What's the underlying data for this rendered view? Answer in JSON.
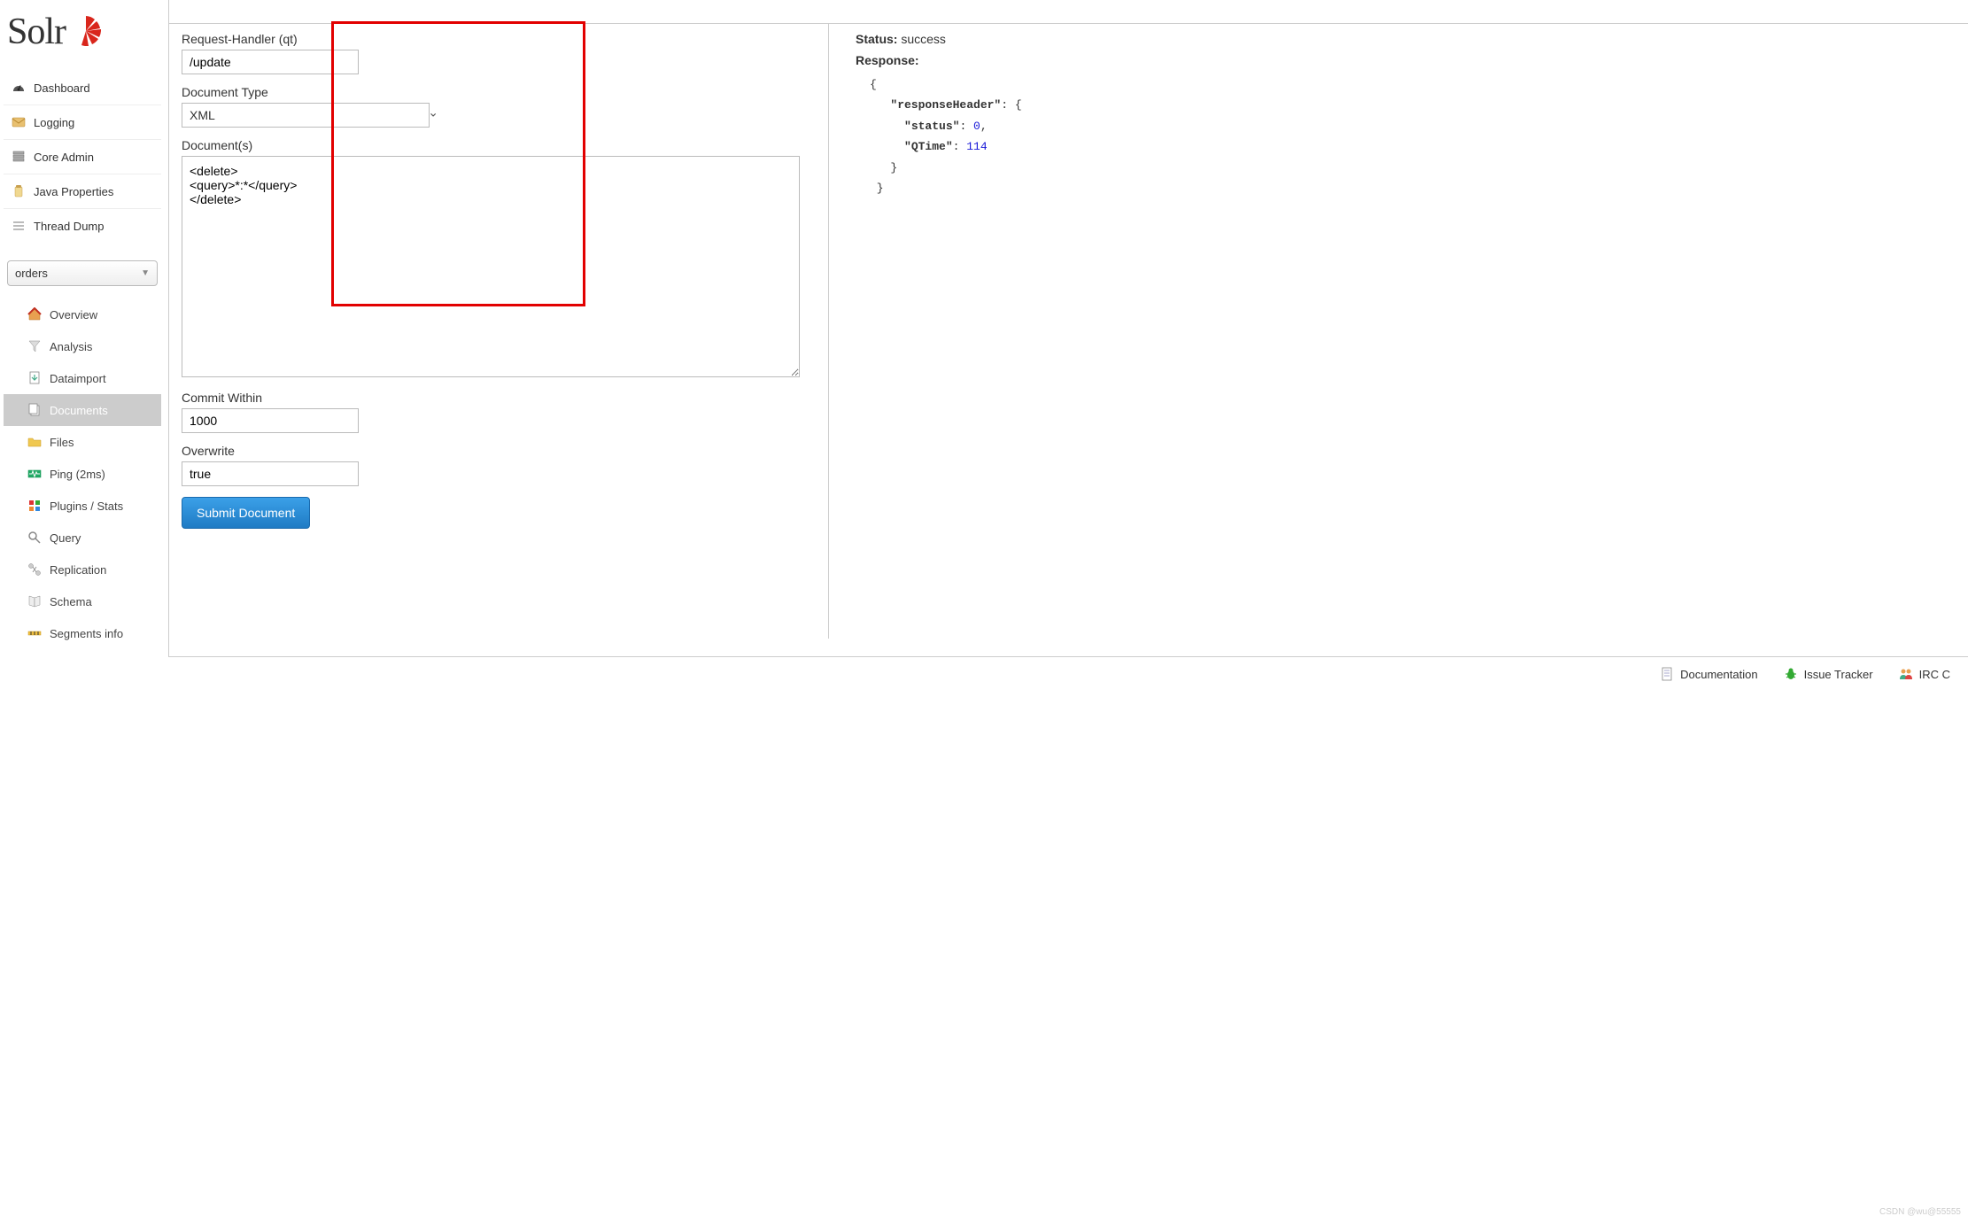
{
  "logo": {
    "text": "Solr"
  },
  "nav": {
    "items": [
      {
        "label": "Dashboard",
        "icon": "gauge-icon"
      },
      {
        "label": "Logging",
        "icon": "inbox-icon"
      },
      {
        "label": "Core Admin",
        "icon": "server-icon"
      },
      {
        "label": "Java Properties",
        "icon": "jar-icon"
      },
      {
        "label": "Thread Dump",
        "icon": "stack-icon"
      }
    ]
  },
  "coreSelector": {
    "selected": "orders"
  },
  "subnav": {
    "items": [
      {
        "label": "Overview",
        "icon": "home-icon"
      },
      {
        "label": "Analysis",
        "icon": "funnel-icon"
      },
      {
        "label": "Dataimport",
        "icon": "import-icon"
      },
      {
        "label": "Documents",
        "icon": "documents-icon",
        "active": true
      },
      {
        "label": "Files",
        "icon": "folder-icon"
      },
      {
        "label": "Ping (2ms)",
        "icon": "ping-icon"
      },
      {
        "label": "Plugins / Stats",
        "icon": "plugins-icon"
      },
      {
        "label": "Query",
        "icon": "magnify-icon"
      },
      {
        "label": "Replication",
        "icon": "replication-icon"
      },
      {
        "label": "Schema",
        "icon": "book-icon"
      },
      {
        "label": "Segments info",
        "icon": "segments-icon"
      }
    ]
  },
  "form": {
    "requestHandlerLabel": "Request-Handler (qt)",
    "requestHandlerValue": "/update",
    "documentTypeLabel": "Document Type",
    "documentTypeValue": "XML",
    "documentsLabel": "Document(s)",
    "documentsValue": "<delete>\n<query>*:*</query>\n</delete>",
    "commitWithinLabel": "Commit Within",
    "commitWithinValue": "1000",
    "overwriteLabel": "Overwrite",
    "overwriteValue": "true",
    "submitLabel": "Submit Document"
  },
  "response": {
    "statusLabel": "Status:",
    "statusValue": "success",
    "responseLabel": "Response:",
    "json": {
      "responseHeader_key": "\"responseHeader\"",
      "status_key": "\"status\"",
      "status_val": "0",
      "qtime_key": "\"QTime\"",
      "qtime_val": "114"
    }
  },
  "footer": {
    "items": [
      {
        "label": "Documentation",
        "icon": "doc-icon"
      },
      {
        "label": "Issue Tracker",
        "icon": "bug-icon"
      },
      {
        "label": "IRC C",
        "icon": "people-icon"
      }
    ]
  },
  "watermark": "CSDN @wu@55555"
}
